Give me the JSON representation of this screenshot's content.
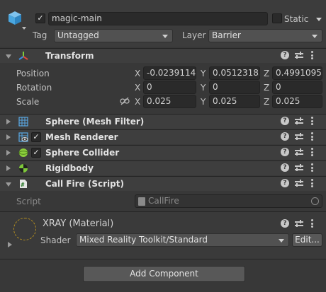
{
  "object": {
    "active_checked": true,
    "name": "magic-main",
    "static_label": "Static",
    "static_checked": false,
    "tag_label": "Tag",
    "tag_value": "Untagged",
    "layer_label": "Layer",
    "layer_value": "Barrier"
  },
  "transform": {
    "title": "Transform",
    "rows": [
      {
        "label": "Position",
        "x": "-0.0239114",
        "y": "0.05123185",
        "z": "0.4991095"
      },
      {
        "label": "Rotation",
        "x": "0",
        "y": "0",
        "z": "0"
      },
      {
        "label": "Scale",
        "x": "0.025",
        "y": "0.025",
        "z": "0.025"
      }
    ],
    "axis_labels": {
      "x": "X",
      "y": "Y",
      "z": "Z"
    }
  },
  "components": {
    "mesh_filter": {
      "title": "Sphere (Mesh Filter)"
    },
    "mesh_renderer": {
      "title": "Mesh Renderer",
      "enabled": true
    },
    "sphere_collider": {
      "title": "Sphere Collider",
      "enabled": true
    },
    "rigidbody": {
      "title": "Rigidbody"
    },
    "call_fire": {
      "title": "Call Fire (Script)",
      "script_label": "Script",
      "script_value": "CallFire"
    }
  },
  "material": {
    "name": "XRAY (Material)",
    "shader_label": "Shader",
    "shader_value": "Mixed Reality Toolkit/Standard",
    "edit_label": "Edit..."
  },
  "footer": {
    "add_component_label": "Add Component"
  },
  "header_icons": {
    "help": "?"
  },
  "colors": {
    "background": "#383838",
    "header": "#3e3e3e",
    "cube_icon": "#4aa7e0",
    "collider_icon": "#8ccf3c",
    "rigidbody_icon": "#7ec83a"
  }
}
